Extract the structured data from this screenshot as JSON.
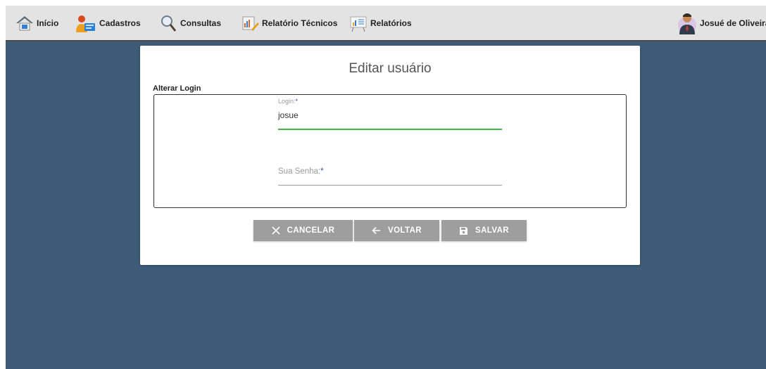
{
  "nav": {
    "items": [
      {
        "label": "Início",
        "icon": "home-icon"
      },
      {
        "label": "Cadastros",
        "icon": "user-register-icon"
      },
      {
        "label": "Consultas",
        "icon": "magnifier-icon"
      },
      {
        "label": "Relatório Técnicos",
        "icon": "technical-report-icon"
      },
      {
        "label": "Relatórios",
        "icon": "chart-report-icon"
      }
    ],
    "user_name": "Josué de Oliveira"
  },
  "card": {
    "title": "Editar usuário",
    "section_label": "Alterar Login",
    "login": {
      "label": "Login:",
      "required_mark": "*",
      "value": "josue"
    },
    "password": {
      "label": "Sua Senha:",
      "required_mark": "*",
      "value": ""
    }
  },
  "buttons": {
    "cancel": "CANCELAR",
    "back": "VOLTAR",
    "save": "SALVAR"
  },
  "colors": {
    "background": "#3e5c78",
    "topbar": "#e3e3e3",
    "button": "#9e9e9e",
    "active_field_line": "#4caf50",
    "required_mark": "#3f51b5"
  }
}
